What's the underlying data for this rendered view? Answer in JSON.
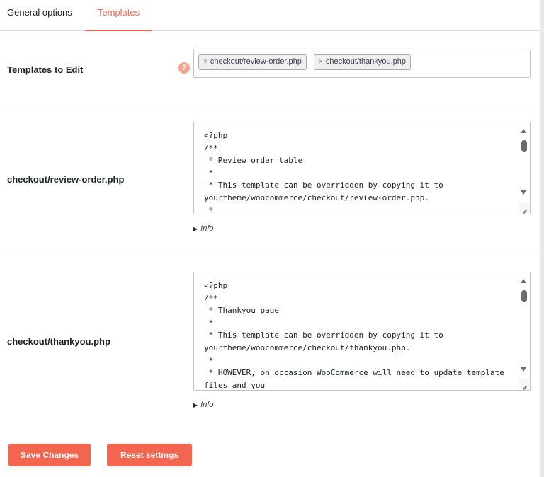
{
  "tabs": [
    {
      "label": "General options"
    },
    {
      "label": "Templates"
    }
  ],
  "templates_to_edit": {
    "label": "Templates to Edit",
    "help": "?",
    "chips": [
      {
        "remove": "×",
        "label": "checkout/review-order.php"
      },
      {
        "remove": "×",
        "label": "checkout/thankyou.php"
      }
    ]
  },
  "editors": [
    {
      "label": "checkout/review-order.php",
      "code": "<?php\n/**\n * Review order table\n *\n * This template can be overridden by copying it to\nyourtheme/woocommerce/checkout/review-order.php.\n *",
      "info": "Info"
    },
    {
      "label": "checkout/thankyou.php",
      "code": "<?php\n/**\n * Thankyou page\n *\n * This template can be overridden by copying it to\nyourtheme/woocommerce/checkout/thankyou.php.\n *\n * HOWEVER, on occasion WooCommerce will need to update template\nfiles and you",
      "info": "Info"
    }
  ],
  "buttons": {
    "save": "Save Changes",
    "reset": "Reset settings"
  },
  "colors": {
    "accent": "#f3654f",
    "help_icon": "#f4a48f"
  }
}
